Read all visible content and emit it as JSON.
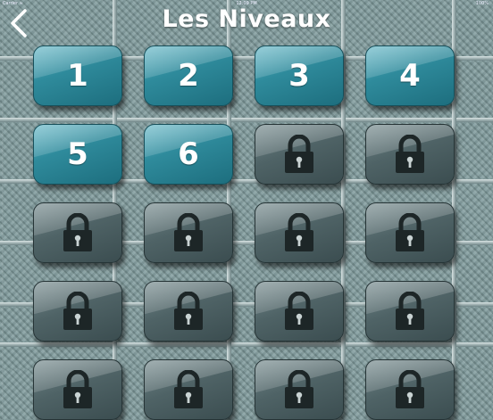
{
  "status_bar": {
    "carrier": "Carrier ≈",
    "time": "12:09 PM",
    "battery": "100%"
  },
  "header": {
    "title": "Les Niveaux",
    "back_icon": "chevron-left-icon"
  },
  "colors": {
    "open_tile": "#2f8b9c",
    "locked_tile": "#4f6366",
    "lock_icon": "#1d2627"
  },
  "levels": [
    {
      "label": "1",
      "locked": false
    },
    {
      "label": "2",
      "locked": false
    },
    {
      "label": "3",
      "locked": false
    },
    {
      "label": "4",
      "locked": false
    },
    {
      "label": "5",
      "locked": false
    },
    {
      "label": "6",
      "locked": false
    },
    {
      "label": "",
      "locked": true
    },
    {
      "label": "",
      "locked": true
    },
    {
      "label": "",
      "locked": true
    },
    {
      "label": "",
      "locked": true
    },
    {
      "label": "",
      "locked": true
    },
    {
      "label": "",
      "locked": true
    },
    {
      "label": "",
      "locked": true
    },
    {
      "label": "",
      "locked": true
    },
    {
      "label": "",
      "locked": true
    },
    {
      "label": "",
      "locked": true
    },
    {
      "label": "",
      "locked": true
    },
    {
      "label": "",
      "locked": true
    },
    {
      "label": "",
      "locked": true
    },
    {
      "label": "",
      "locked": true
    }
  ]
}
